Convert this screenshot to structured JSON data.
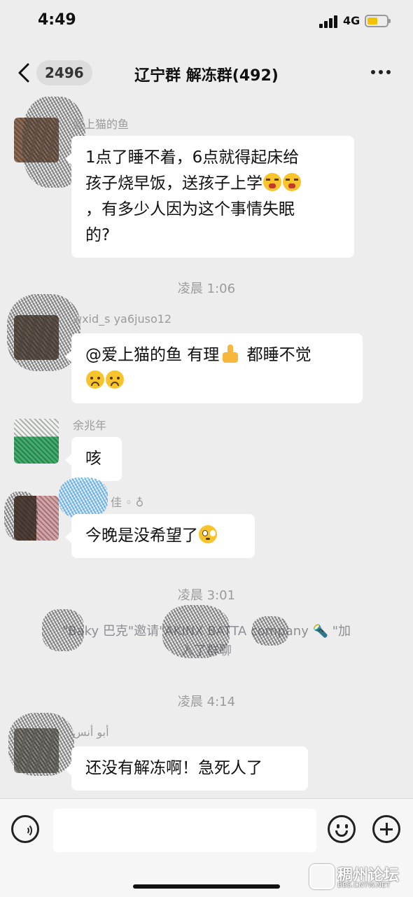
{
  "status_bar": {
    "time": "4:49",
    "network": "4G",
    "battery_color": "#f2c200"
  },
  "nav": {
    "unread_count": "2496",
    "title": "辽宁群 解冻群(492)"
  },
  "messages": [
    {
      "sender": "爱上猫的鱼",
      "lines": [
        {
          "text": "1点了睡不着，6点就得起床给"
        },
        {
          "text": "孩子烧早饭，送孩子上学",
          "emojis": [
            "tired-face-emoji",
            "tired-face-emoji"
          ]
        },
        {
          "text": "，有多少人因为这个事情失眠"
        },
        {
          "text": "的?"
        }
      ]
    },
    {
      "sender": "wxid_s      ya6juso12",
      "parts": [
        "@爱上猫的鱼 有理",
        "都睡不觉"
      ],
      "emojis": [
        "thumbs-up-emoji",
        "frowning-face-emoji",
        "frowning-face-emoji"
      ]
    },
    {
      "sender": "余兆年",
      "text": "咳"
    },
    {
      "sender": "佳 ◦ ♁",
      "text": "今晚是没希望了",
      "emojis": [
        "pleading-face-emoji"
      ]
    },
    {
      "sender": "أبو أنس",
      "text": "还没有解冻啊！急死人了"
    }
  ],
  "timestamps": [
    "凌晨 1:06",
    "凌晨 3:01",
    "凌晨 4:14"
  ],
  "system_message": {
    "line1": "\"Baky 巴克\"邀请\"AKINX  BATTA company 🔦 \"加",
    "line2": "入了群聊"
  },
  "watermark": {
    "name": "稠州论坛",
    "url": "BBS.CNYW.NET"
  }
}
